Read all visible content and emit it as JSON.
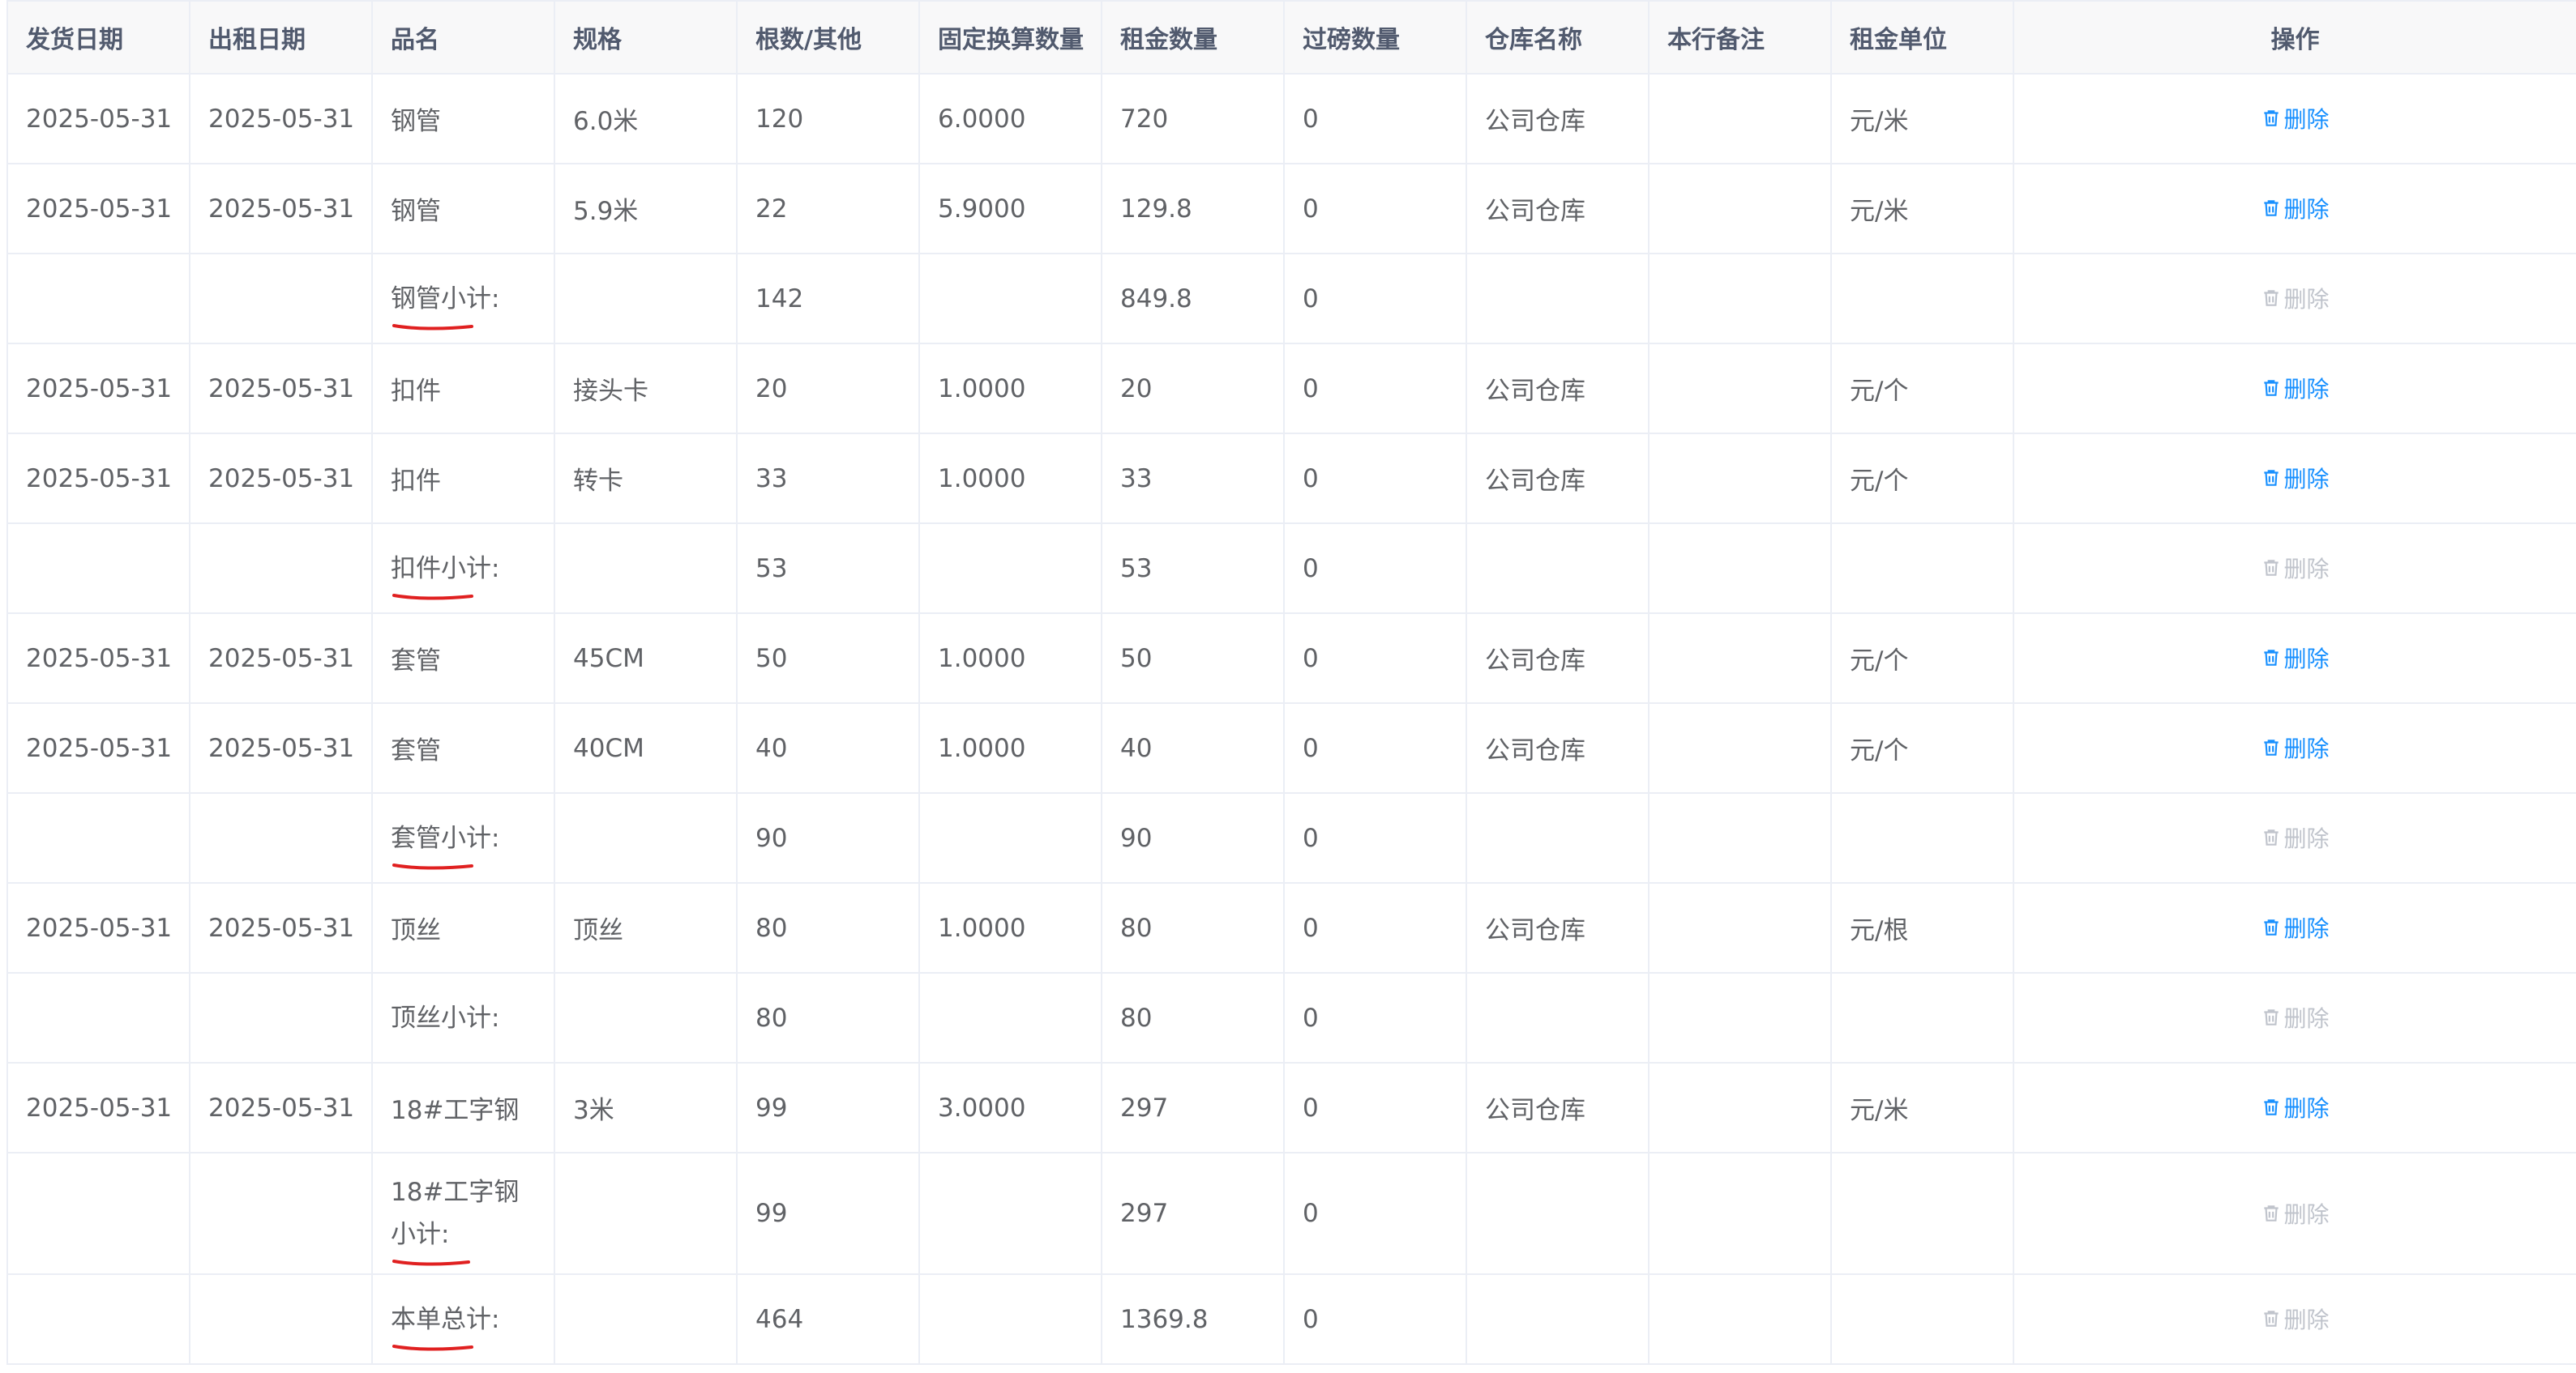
{
  "table": {
    "headers": [
      "发货日期",
      "出租日期",
      "品名",
      "规格",
      "根数/其他",
      "固定换算数量",
      "租金数量",
      "过磅数量",
      "仓库名称",
      "本行备注",
      "租金单位",
      "操作"
    ],
    "delete_label": "删除",
    "rows": [
      {
        "type": "data",
        "cells": [
          "2025-05-31",
          "2025-05-31",
          "钢管",
          "6.0米",
          "120",
          "6.0000",
          "720",
          "0",
          "公司仓库",
          "",
          "元/米"
        ]
      },
      {
        "type": "data",
        "cells": [
          "2025-05-31",
          "2025-05-31",
          "钢管",
          "5.9米",
          "22",
          "5.9000",
          "129.8",
          "0",
          "公司仓库",
          "",
          "元/米"
        ]
      },
      {
        "type": "subtotal",
        "underline": true,
        "cells": [
          "",
          "",
          "钢管小计:",
          "",
          "142",
          "",
          "849.8",
          "0",
          "",
          "",
          ""
        ]
      },
      {
        "type": "data",
        "cells": [
          "2025-05-31",
          "2025-05-31",
          "扣件",
          "接头卡",
          "20",
          "1.0000",
          "20",
          "0",
          "公司仓库",
          "",
          "元/个"
        ]
      },
      {
        "type": "data",
        "cells": [
          "2025-05-31",
          "2025-05-31",
          "扣件",
          "转卡",
          "33",
          "1.0000",
          "33",
          "0",
          "公司仓库",
          "",
          "元/个"
        ]
      },
      {
        "type": "subtotal",
        "underline": true,
        "cells": [
          "",
          "",
          "扣件小计:",
          "",
          "53",
          "",
          "53",
          "0",
          "",
          "",
          ""
        ]
      },
      {
        "type": "data",
        "cells": [
          "2025-05-31",
          "2025-05-31",
          "套管",
          "45CM",
          "50",
          "1.0000",
          "50",
          "0",
          "公司仓库",
          "",
          "元/个"
        ]
      },
      {
        "type": "data",
        "cells": [
          "2025-05-31",
          "2025-05-31",
          "套管",
          "40CM",
          "40",
          "1.0000",
          "40",
          "0",
          "公司仓库",
          "",
          "元/个"
        ]
      },
      {
        "type": "subtotal",
        "underline": true,
        "cells": [
          "",
          "",
          "套管小计:",
          "",
          "90",
          "",
          "90",
          "0",
          "",
          "",
          ""
        ]
      },
      {
        "type": "data",
        "cells": [
          "2025-05-31",
          "2025-05-31",
          "顶丝",
          "顶丝",
          "80",
          "1.0000",
          "80",
          "0",
          "公司仓库",
          "",
          "元/根"
        ]
      },
      {
        "type": "subtotal",
        "underline": false,
        "cells": [
          "",
          "",
          "顶丝小计:",
          "",
          "80",
          "",
          "80",
          "0",
          "",
          "",
          ""
        ]
      },
      {
        "type": "data",
        "cells": [
          "2025-05-31",
          "2025-05-31",
          "18#工字钢",
          "3米",
          "99",
          "3.0000",
          "297",
          "0",
          "公司仓库",
          "",
          "元/米"
        ]
      },
      {
        "type": "subtotal",
        "underline": true,
        "tall": true,
        "cells": [
          "",
          "",
          "18#工字钢小计:",
          "",
          "99",
          "",
          "297",
          "0",
          "",
          "",
          ""
        ]
      },
      {
        "type": "total",
        "underline": true,
        "cells": [
          "",
          "",
          "本单总计:",
          "",
          "464",
          "",
          "1369.8",
          "0",
          "",
          "",
          ""
        ]
      }
    ]
  },
  "colors": {
    "link": "#1890ff",
    "disabled": "#c0c4cc",
    "annotation": "#e02020"
  },
  "icons": {
    "delete": "trash-icon"
  }
}
